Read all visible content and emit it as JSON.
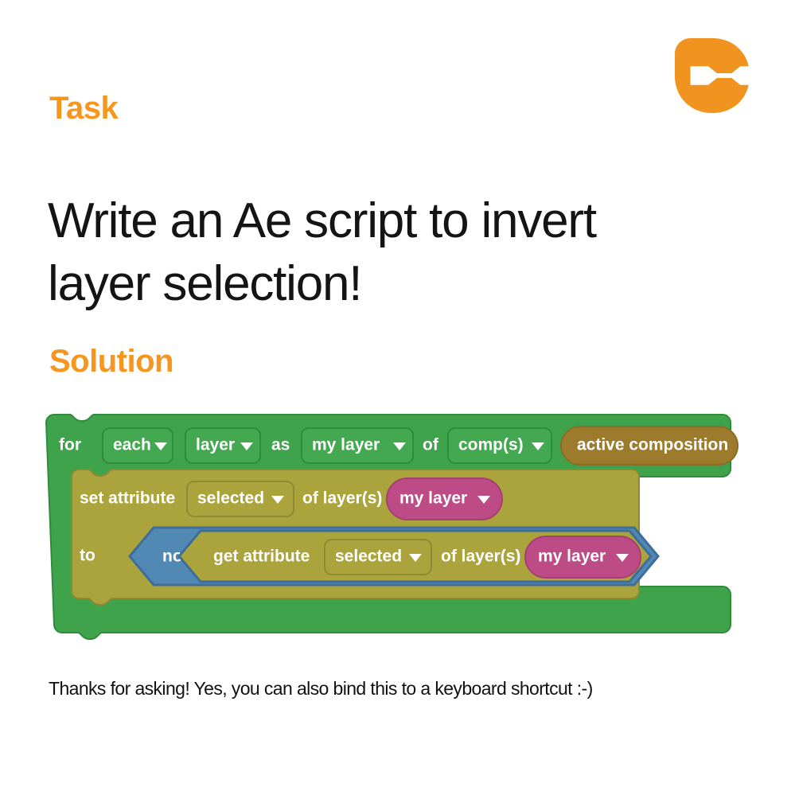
{
  "brand": {
    "logo_icon": "c-plug-logo-icon",
    "accent_color": "#F7961E",
    "logo_color": "#F0941F"
  },
  "sections": {
    "task_label": "Task",
    "solution_label": "Solution"
  },
  "headline": {
    "line1": "Write an Ae script to invert",
    "line2": "layer selection!"
  },
  "footnote": {
    "text": "Thanks for asking! Yes, you can also bind this to a keyboard shortcut :-)"
  },
  "palette": {
    "loop_green": "#3EA34A",
    "loop_green_dark": "#2F8C3B",
    "field_green": "#43A84F",
    "olive": "#ABA43C",
    "olive_dark": "#8F8A32",
    "tan": "#9C7B2C",
    "pink": "#BD4B86",
    "blue": "#5288B4",
    "blue_dark": "#3E6E99",
    "text_white": "#FFFFFF"
  },
  "blocks": {
    "loop": {
      "name": "for-each-loop-block",
      "label_for": "for",
      "field_each": {
        "value": "each",
        "icon": "chevron-down-icon"
      },
      "field_layer": {
        "value": "layer",
        "icon": "chevron-down-icon"
      },
      "label_as": "as",
      "field_my_layer": {
        "value": "my layer",
        "icon": "chevron-down-icon"
      },
      "label_of": "of",
      "field_comps": {
        "value": "comp(s)",
        "icon": "chevron-down-icon"
      },
      "pill_active_composition": {
        "value": "active composition"
      }
    },
    "set_attribute": {
      "name": "set-attribute-block",
      "label_set": "set attribute",
      "field_selected": {
        "value": "selected",
        "icon": "chevron-down-icon"
      },
      "label_of_layers": "of layer(s)",
      "pill_my_layer": {
        "value": "my layer",
        "icon": "chevron-down-icon"
      },
      "label_to": "to"
    },
    "not_operator": {
      "name": "not-operator-block",
      "label": "not"
    },
    "get_attribute": {
      "name": "get-attribute-block",
      "label_get": "get attribute",
      "field_selected": {
        "value": "selected",
        "icon": "chevron-down-icon"
      },
      "label_of_layers": "of layer(s)",
      "pill_my_layer": {
        "value": "my layer",
        "icon": "chevron-down-icon"
      }
    }
  }
}
